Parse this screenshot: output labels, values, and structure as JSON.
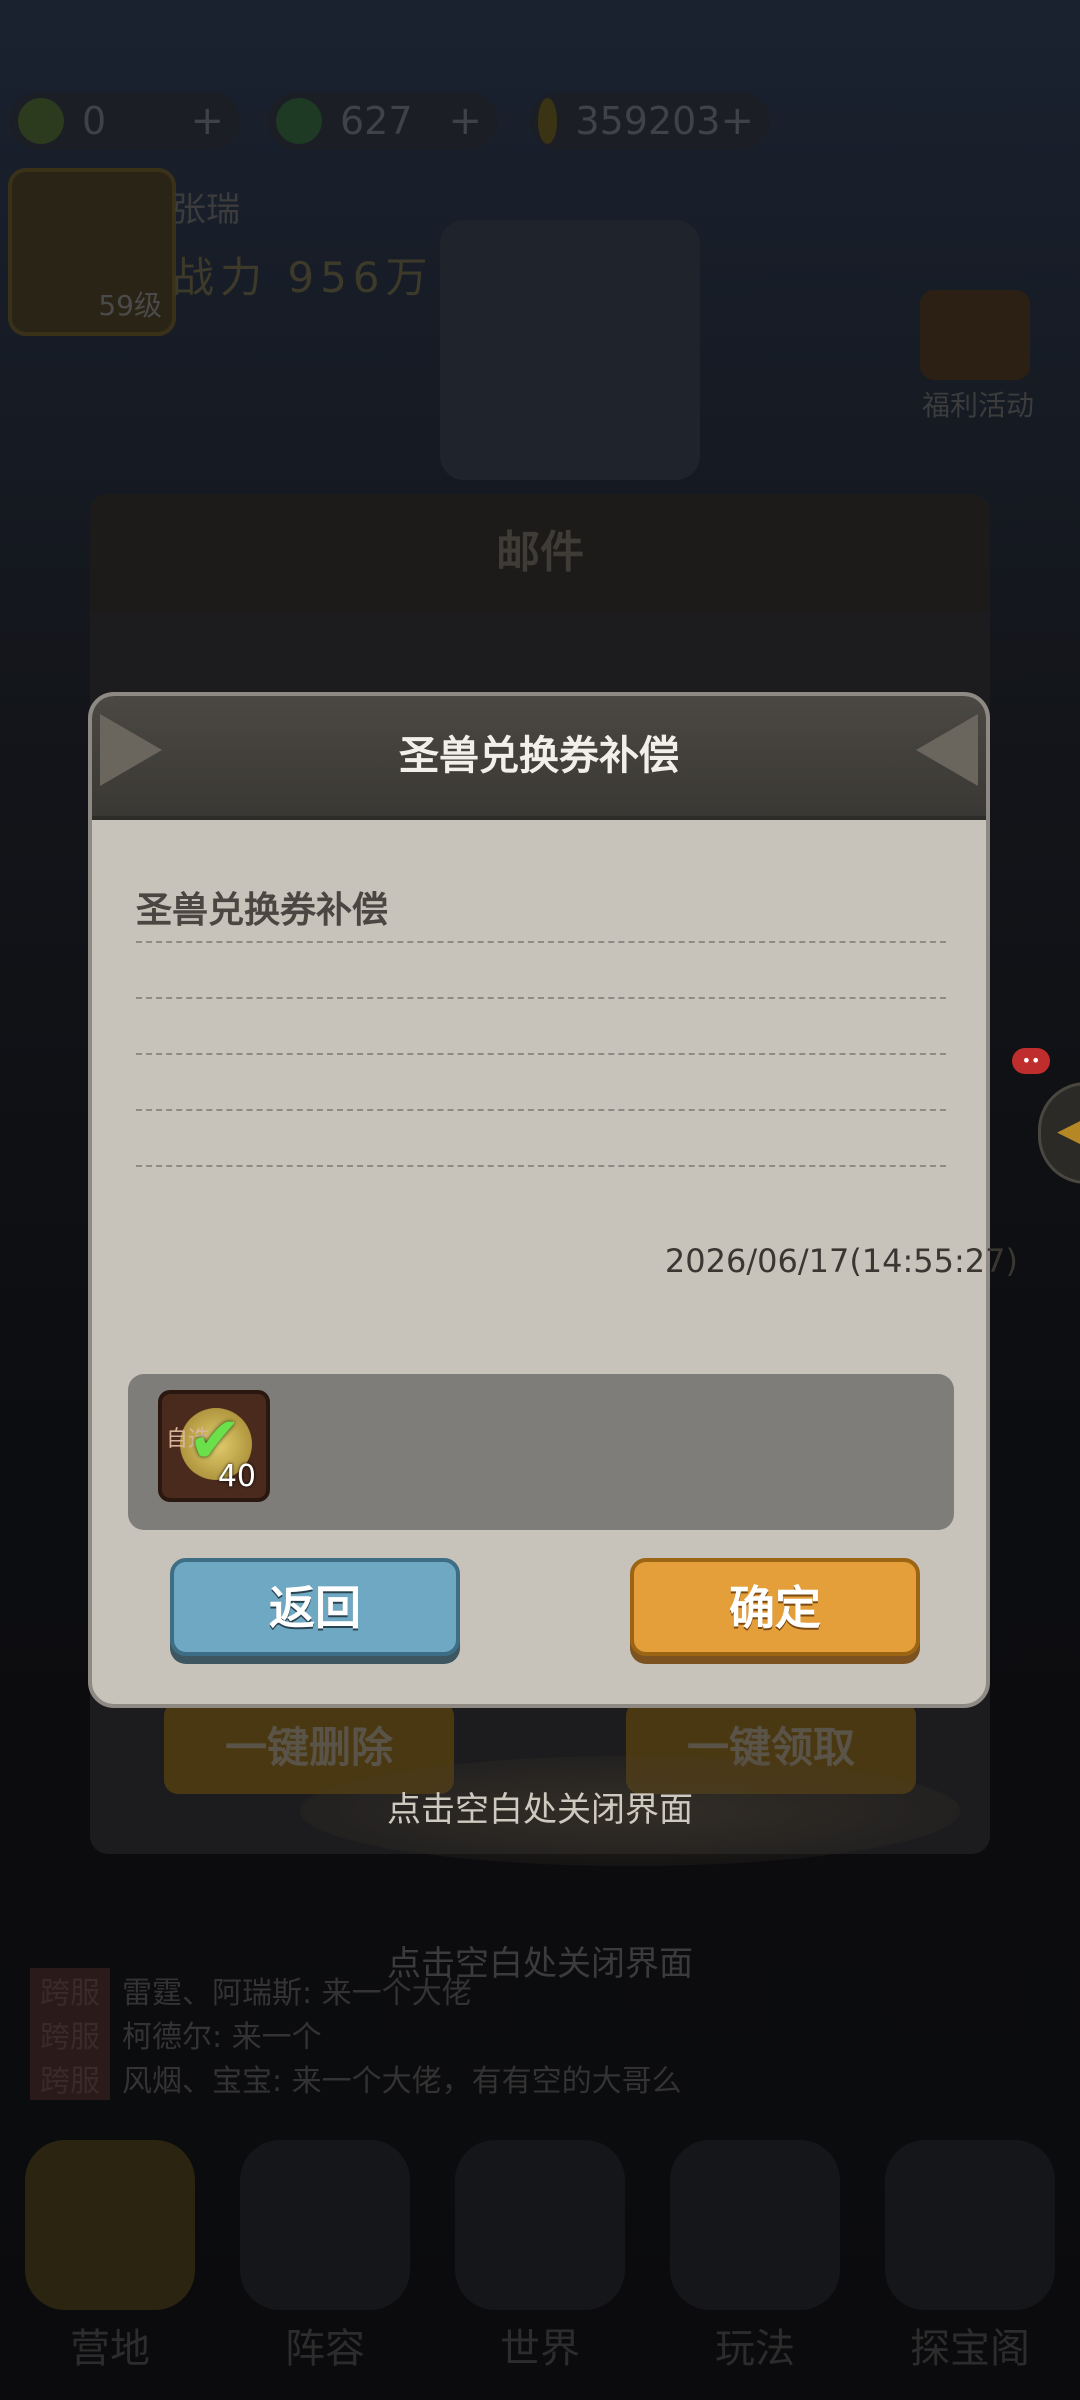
{
  "resources": [
    {
      "icon": "leaf-coin-icon",
      "value": "0",
      "plus": "+"
    },
    {
      "icon": "green-gem-icon",
      "value": "627",
      "plus": "+"
    },
    {
      "icon": "gold-coin-icon",
      "value": "359203",
      "plus": "+"
    }
  ],
  "player": {
    "name": "张瑞",
    "power": "战力 956万",
    "level": "59级"
  },
  "side": {
    "gift_label": "福利活动"
  },
  "chat_lines": [
    {
      "tag": "跨服",
      "text": "雷霆、阿瑞斯: 来一个大佬"
    },
    {
      "tag": "跨服",
      "text": "柯德尔: 来一个"
    },
    {
      "tag": "跨服",
      "text": "风烟、宝宝: 来一个大佬，有有空的大哥么"
    }
  ],
  "bottom_nav": [
    {
      "label": "营地"
    },
    {
      "label": "阵容"
    },
    {
      "label": "世界"
    },
    {
      "label": "玩法"
    },
    {
      "label": "探宝阁"
    }
  ],
  "mail": {
    "title": "邮件",
    "delete_all": "一键删除",
    "claim_all": "一键领取",
    "close_hint": "点击空白处关闭界面"
  },
  "background_hint": "点击空白处关闭界面",
  "dialog": {
    "title": "圣兽兑换券补偿",
    "message": "圣兽兑换券补偿",
    "timestamp": "2026/06/17(14:55:27)",
    "attachment": {
      "icon": "exchange-voucher-icon",
      "select_label": "自选",
      "count": "40",
      "claimed": true
    },
    "back_button": "返回",
    "confirm_button": "确定"
  },
  "colors": {
    "back_button": "#6fa8c2",
    "confirm_button": "#e49f3a",
    "dialog_bg": "#c7c3bb",
    "header_bg": "#3a3834"
  }
}
